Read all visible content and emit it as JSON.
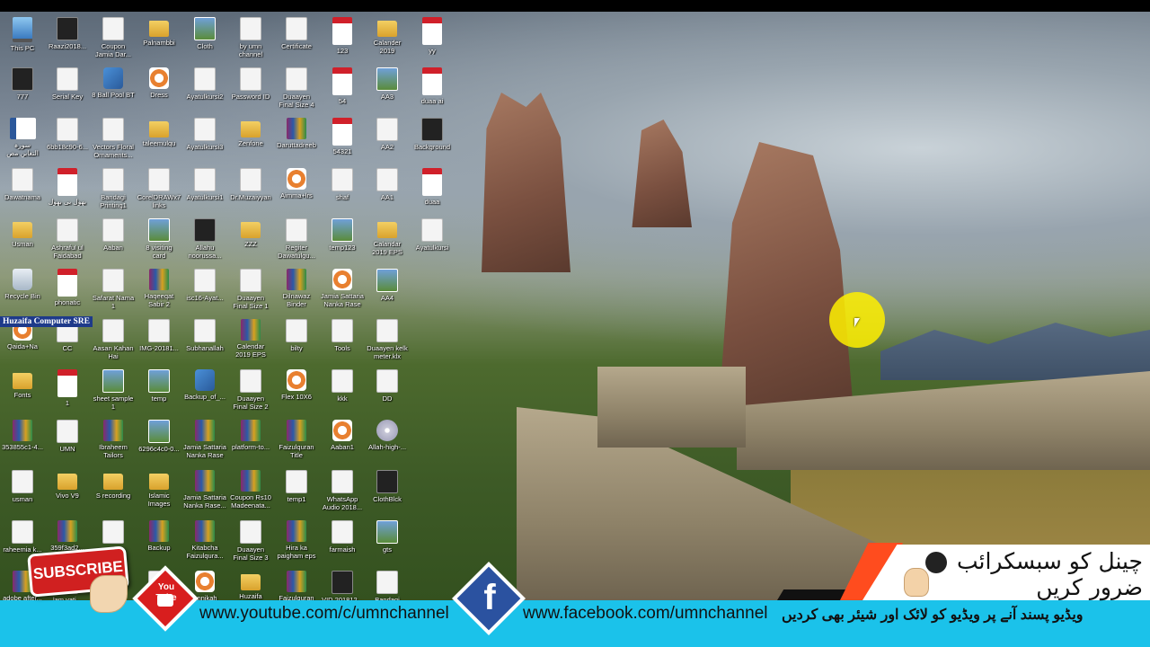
{
  "desktop": {
    "watermark": "Huzaifa Computer SRE",
    "icons": [
      {
        "label": "This PC",
        "type": "pc",
        "col": 0,
        "row": 0
      },
      {
        "label": "Raazi2018...",
        "type": "dark",
        "col": 1,
        "row": 0
      },
      {
        "label": "Coupon\nJamia Dar...",
        "type": "file",
        "col": 2,
        "row": 0
      },
      {
        "label": "Palnambbi",
        "type": "folder",
        "col": 3,
        "row": 0
      },
      {
        "label": "Cloth",
        "type": "img",
        "col": 4,
        "row": 0
      },
      {
        "label": "by umn\nchannel",
        "type": "file",
        "col": 5,
        "row": 0
      },
      {
        "label": "Certificate",
        "type": "file",
        "col": 6,
        "row": 0
      },
      {
        "label": "123",
        "type": "pdf",
        "col": 7,
        "row": 0
      },
      {
        "label": "Calander\n2019",
        "type": "folder",
        "col": 8,
        "row": 0
      },
      {
        "label": "yy",
        "type": "pdf",
        "col": 9,
        "row": 0
      },
      {
        "label": "777",
        "type": "dark",
        "col": 0,
        "row": 1
      },
      {
        "label": "Serial Key",
        "type": "file",
        "col": 1,
        "row": 1
      },
      {
        "label": "8 Ball Pool BT",
        "type": "exe",
        "col": 2,
        "row": 1
      },
      {
        "label": "Dress",
        "type": "app",
        "col": 3,
        "row": 1
      },
      {
        "label": "Ayatulkursi2",
        "type": "file",
        "col": 4,
        "row": 1
      },
      {
        "label": "Password ID",
        "type": "file",
        "col": 5,
        "row": 1
      },
      {
        "label": "Duaayen\nFinal Size 4",
        "type": "file",
        "col": 6,
        "row": 1
      },
      {
        "label": "54",
        "type": "pdf",
        "col": 7,
        "row": 1
      },
      {
        "label": "AA3",
        "type": "img",
        "col": 8,
        "row": 1
      },
      {
        "label": "duaa ai",
        "type": "pdf",
        "col": 9,
        "row": 1
      },
      {
        "label": "سورہ\nالتغابن مص",
        "type": "word",
        "col": 0,
        "row": 2
      },
      {
        "label": "6bb18c90-6...",
        "type": "file",
        "col": 1,
        "row": 2
      },
      {
        "label": "Vectors Floral\nOrnaments...",
        "type": "file",
        "col": 2,
        "row": 2
      },
      {
        "label": "taleemulqu",
        "type": "folder",
        "col": 3,
        "row": 2
      },
      {
        "label": "Ayatulkursi3",
        "type": "file",
        "col": 4,
        "row": 2
      },
      {
        "label": "Zenfone",
        "type": "folder",
        "col": 5,
        "row": 2
      },
      {
        "label": "Daruttadreeb",
        "type": "rar",
        "col": 6,
        "row": 2
      },
      {
        "label": "54321",
        "type": "pdf",
        "col": 7,
        "row": 2
      },
      {
        "label": "AA2",
        "type": "file",
        "col": 8,
        "row": 2
      },
      {
        "label": "Background",
        "type": "dark",
        "col": 9,
        "row": 2
      },
      {
        "label": "Dawatnama",
        "type": "file",
        "col": 0,
        "row": 3
      },
      {
        "label": "بھول بی بھول",
        "type": "pdf",
        "col": 1,
        "row": 3
      },
      {
        "label": "Bandagi\nPrinting1",
        "type": "file",
        "col": 2,
        "row": 3
      },
      {
        "label": "CorelDRAWx7\nlinks",
        "type": "file",
        "col": 3,
        "row": 3
      },
      {
        "label": "Ayatulkursi1",
        "type": "file",
        "col": 4,
        "row": 3
      },
      {
        "label": "Dr.Muzaiyyan",
        "type": "file",
        "col": 5,
        "row": 3
      },
      {
        "label": "Aimma+lrs",
        "type": "app",
        "col": 6,
        "row": 3
      },
      {
        "label": "shaf",
        "type": "file",
        "col": 7,
        "row": 3
      },
      {
        "label": "AA1",
        "type": "file",
        "col": 8,
        "row": 3
      },
      {
        "label": "duaa",
        "type": "pdf",
        "col": 9,
        "row": 3
      },
      {
        "label": "Usman",
        "type": "folder",
        "col": 0,
        "row": 4
      },
      {
        "label": "Ashraful ul\nFaidabad",
        "type": "file",
        "col": 1,
        "row": 4
      },
      {
        "label": "Aaban",
        "type": "file",
        "col": 2,
        "row": 4
      },
      {
        "label": "8 visiting\ncard",
        "type": "img",
        "col": 3,
        "row": 4
      },
      {
        "label": "Allahu\nnoorussa...",
        "type": "dark",
        "col": 4,
        "row": 4
      },
      {
        "label": "ZZZ",
        "type": "folder",
        "col": 5,
        "row": 4
      },
      {
        "label": "Regiter\nDawatulgu...",
        "type": "file",
        "col": 6,
        "row": 4
      },
      {
        "label": "temp123",
        "type": "img",
        "col": 7,
        "row": 4
      },
      {
        "label": "Calandar\n2019 EPS",
        "type": "folder",
        "col": 8,
        "row": 4
      },
      {
        "label": "Ayatulkursi",
        "type": "file",
        "col": 9,
        "row": 4
      },
      {
        "label": "Recycle Bin",
        "type": "bin",
        "col": 0,
        "row": 5
      },
      {
        "label": "phonatic",
        "type": "pdf",
        "col": 1,
        "row": 5
      },
      {
        "label": "Safarat Nama\n1",
        "type": "file",
        "col": 2,
        "row": 5
      },
      {
        "label": "Haqeeqat\nSabir 2",
        "type": "rar",
        "col": 3,
        "row": 5
      },
      {
        "label": "isc16-Ayat...",
        "type": "file",
        "col": 4,
        "row": 5
      },
      {
        "label": "Duaayen\nFinal Size 1",
        "type": "file",
        "col": 5,
        "row": 5
      },
      {
        "label": "Dilnawaz\nBinder",
        "type": "rar",
        "col": 6,
        "row": 5
      },
      {
        "label": "Jamia Sattaria\nNanka Rase",
        "type": "app",
        "col": 7,
        "row": 5
      },
      {
        "label": "AA4",
        "type": "img",
        "col": 8,
        "row": 5
      },
      {
        "label": "Qaida+Na",
        "type": "app",
        "col": 0,
        "row": 6
      },
      {
        "label": "CC",
        "type": "file",
        "col": 1,
        "row": 6
      },
      {
        "label": "Aasan Kahan\nHai",
        "type": "file",
        "col": 2,
        "row": 6
      },
      {
        "label": "IMG-20181...",
        "type": "file",
        "col": 3,
        "row": 6
      },
      {
        "label": "Subhanallah",
        "type": "file",
        "col": 4,
        "row": 6
      },
      {
        "label": "Calendar\n2019 EPS",
        "type": "rar",
        "col": 5,
        "row": 6
      },
      {
        "label": "bilty",
        "type": "file",
        "col": 6,
        "row": 6
      },
      {
        "label": "Tools",
        "type": "file",
        "col": 7,
        "row": 6
      },
      {
        "label": "Duaayen kelk\nmeter.klx",
        "type": "file",
        "col": 8,
        "row": 6
      },
      {
        "label": "Fonts",
        "type": "folder",
        "col": 0,
        "row": 7
      },
      {
        "label": "1",
        "type": "pdf",
        "col": 1,
        "row": 7
      },
      {
        "label": "sheet sample\n1",
        "type": "img",
        "col": 2,
        "row": 7
      },
      {
        "label": "temp",
        "type": "img",
        "col": 3,
        "row": 7
      },
      {
        "label": "Backup_of_...",
        "type": "exe",
        "col": 4,
        "row": 7
      },
      {
        "label": "Duaayen\nFinal Size 2",
        "type": "file",
        "col": 5,
        "row": 7
      },
      {
        "label": "Flex 10X6",
        "type": "app",
        "col": 6,
        "row": 7
      },
      {
        "label": "kkk",
        "type": "file",
        "col": 7,
        "row": 7
      },
      {
        "label": "DD",
        "type": "file",
        "col": 8,
        "row": 7
      },
      {
        "label": "353855c1-4...",
        "type": "rar",
        "col": 0,
        "row": 8
      },
      {
        "label": "UMN",
        "type": "file",
        "col": 1,
        "row": 8
      },
      {
        "label": "Ibraheem\nTailors",
        "type": "rar",
        "col": 2,
        "row": 8
      },
      {
        "label": "6296c4c0-0...",
        "type": "img",
        "col": 3,
        "row": 8
      },
      {
        "label": "Jamia Sattaria\nNanka Rase",
        "type": "rar",
        "col": 4,
        "row": 8
      },
      {
        "label": "platform-to...",
        "type": "rar",
        "col": 5,
        "row": 8
      },
      {
        "label": "Faizulquran\nTitle",
        "type": "rar",
        "col": 6,
        "row": 8
      },
      {
        "label": "Aaban1",
        "type": "app",
        "col": 7,
        "row": 8
      },
      {
        "label": "Allah-high-...",
        "type": "cd",
        "col": 8,
        "row": 8
      },
      {
        "label": "usman",
        "type": "file",
        "col": 0,
        "row": 9
      },
      {
        "label": "Vivo V9",
        "type": "folder",
        "col": 1,
        "row": 9
      },
      {
        "label": "S recording",
        "type": "folder",
        "col": 2,
        "row": 9
      },
      {
        "label": "Islamic\nImages",
        "type": "folder",
        "col": 3,
        "row": 9
      },
      {
        "label": "Jamia Sattaria\nNanka Rase...",
        "type": "rar",
        "col": 4,
        "row": 9
      },
      {
        "label": "Coupon Rs10\nMadeenata...",
        "type": "rar",
        "col": 5,
        "row": 9
      },
      {
        "label": "temp1",
        "type": "file",
        "col": 6,
        "row": 9
      },
      {
        "label": "WhatsApp\nAudio 2018...",
        "type": "file",
        "col": 7,
        "row": 9
      },
      {
        "label": "ClothBlck",
        "type": "dark",
        "col": 8,
        "row": 9
      },
      {
        "label": "raheemia k...",
        "type": "file",
        "col": 0,
        "row": 10
      },
      {
        "label": "359f3ad2...",
        "type": "rar",
        "col": 1,
        "row": 10
      },
      {
        "label": "1",
        "type": "file",
        "col": 2,
        "row": 10
      },
      {
        "label": "Backup",
        "type": "rar",
        "col": 3,
        "row": 10
      },
      {
        "label": "Kitabcha\nFaizulqura...",
        "type": "rar",
        "col": 4,
        "row": 10
      },
      {
        "label": "Duaayen\nFinal Size 3",
        "type": "file",
        "col": 5,
        "row": 10
      },
      {
        "label": "Hira ka\npaigham eps",
        "type": "rar",
        "col": 6,
        "row": 10
      },
      {
        "label": "farmaish",
        "type": "file",
        "col": 7,
        "row": 10
      },
      {
        "label": "gts",
        "type": "img",
        "col": 8,
        "row": 10
      },
      {
        "label": "adobe after...",
        "type": "rar",
        "col": 0,
        "row": 11
      },
      {
        "label": "lam vati...",
        "type": "file",
        "col": 1,
        "row": 11
      },
      {
        "label": "",
        "type": "file",
        "col": 2,
        "row": 11
      },
      {
        "label": "",
        "type": "file",
        "col": 3,
        "row": 11
      },
      {
        "label": "Annikah",
        "type": "app",
        "col": 4,
        "row": 11
      },
      {
        "label": "Huzaifa",
        "type": "folder",
        "col": 5,
        "row": 11
      },
      {
        "label": "Faizulquran",
        "type": "rar",
        "col": 6,
        "row": 11
      },
      {
        "label": "VID 201812...",
        "type": "dark",
        "col": 7,
        "row": 11
      },
      {
        "label": "Bandagi",
        "type": "file",
        "col": 8,
        "row": 11
      }
    ]
  },
  "overlay": {
    "subscribe_label": "SUBSCRIBE",
    "youtube_label": "You\nTube",
    "facebook_letter": "f",
    "youtube_url": "www.youtube.com/c/umnchannel",
    "facebook_url": "www.facebook.com/umnchannel",
    "urdu_top": "چینل کو سبسکرائب ضرور کریں",
    "urdu_bottom": "ویڈیو پسند آنے پر ویڈیو کو لائک اور شیئر بھی کردیں",
    "colors": {
      "bar": "#1bc2ea",
      "accent": "#ff4c1e",
      "youtube": "#d81e1e",
      "facebook": "#2b52a0",
      "highlight": "#fff000"
    }
  }
}
